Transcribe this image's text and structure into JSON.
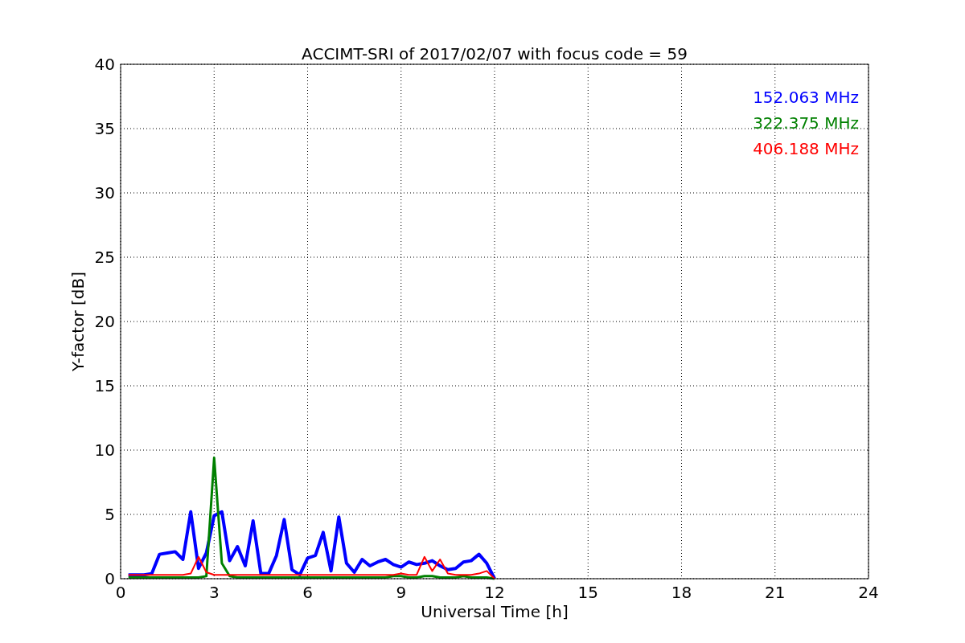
{
  "chart_data": {
    "type": "line",
    "title": "ACCIMT-SRI of 2017/02/07 with focus code = 59",
    "xlabel": "Universal Time [h]",
    "ylabel": "Y-factor [dB]",
    "x": [
      0.25,
      0.5,
      0.75,
      1,
      1.25,
      1.5,
      1.75,
      2,
      2.25,
      2.5,
      2.75,
      3,
      3.25,
      3.5,
      3.75,
      4,
      4.25,
      4.5,
      4.75,
      5,
      5.25,
      5.5,
      5.75,
      6,
      6.25,
      6.5,
      6.75,
      7,
      7.25,
      7.5,
      7.75,
      8,
      8.25,
      8.5,
      8.75,
      9,
      9.25,
      9.5,
      9.75,
      10,
      10.25,
      10.5,
      10.75,
      11,
      11.25,
      11.5,
      11.75,
      12
    ],
    "series": [
      {
        "name": "152.063 MHz",
        "color": "#0000ff",
        "values": [
          0.3,
          0.3,
          0.3,
          0.4,
          1.9,
          2.0,
          2.1,
          1.5,
          5.2,
          0.8,
          2.0,
          4.9,
          5.2,
          1.4,
          2.5,
          1.0,
          4.5,
          0.4,
          0.4,
          1.8,
          4.6,
          0.7,
          0.3,
          1.6,
          1.8,
          3.6,
          0.6,
          4.8,
          1.2,
          0.5,
          1.5,
          1.0,
          1.3,
          1.5,
          1.1,
          0.9,
          1.3,
          1.1,
          1.2,
          1.4,
          1.0,
          0.7,
          0.8,
          1.3,
          1.4,
          1.9,
          1.2,
          0.0
        ]
      },
      {
        "name": "322.375 MHz",
        "color": "#008000",
        "values": [
          0.1,
          0.1,
          0.1,
          0.1,
          0.1,
          0.1,
          0.1,
          0.1,
          0.1,
          0.1,
          0.2,
          9.4,
          1.2,
          0.2,
          0.1,
          0.1,
          0.1,
          0.1,
          0.1,
          0.1,
          0.1,
          0.1,
          0.1,
          0.1,
          0.1,
          0.1,
          0.1,
          0.1,
          0.1,
          0.1,
          0.1,
          0.1,
          0.1,
          0.1,
          0.2,
          0.2,
          0.1,
          0.1,
          0.2,
          0.2,
          0.1,
          0.1,
          0.1,
          0.2,
          0.1,
          0.1,
          0.1,
          0.0
        ]
      },
      {
        "name": "406.188 MHz",
        "color": "#ff0000",
        "values": [
          0.3,
          0.3,
          0.3,
          0.3,
          0.3,
          0.3,
          0.3,
          0.3,
          0.4,
          1.7,
          0.5,
          0.3,
          0.3,
          0.3,
          0.3,
          0.3,
          0.3,
          0.3,
          0.3,
          0.3,
          0.3,
          0.3,
          0.3,
          0.3,
          0.3,
          0.3,
          0.3,
          0.3,
          0.3,
          0.3,
          0.3,
          0.3,
          0.3,
          0.3,
          0.3,
          0.4,
          0.3,
          0.3,
          1.7,
          0.6,
          1.5,
          0.4,
          0.3,
          0.3,
          0.3,
          0.4,
          0.6,
          0.0
        ]
      }
    ],
    "grid": true,
    "xlim": [
      0,
      24
    ],
    "ylim": [
      0,
      40
    ],
    "xticks": [
      0,
      3,
      6,
      9,
      12,
      15,
      18,
      21,
      24
    ],
    "yticks": [
      0,
      5,
      10,
      15,
      20,
      25,
      30,
      35,
      40
    ]
  }
}
